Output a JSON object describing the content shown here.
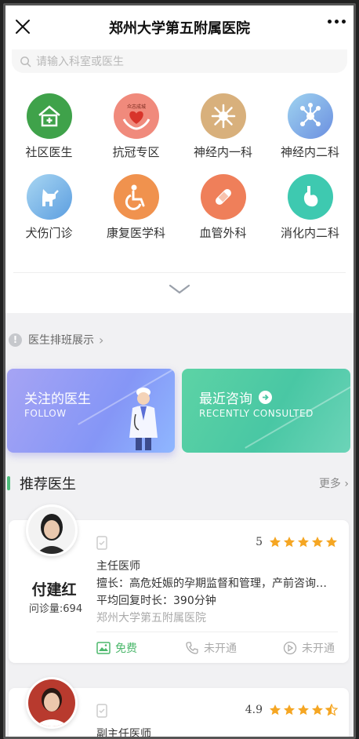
{
  "header": {
    "title": "郑州大学第五附属医院"
  },
  "search": {
    "placeholder": "请输入科室或医生"
  },
  "departments": [
    {
      "label": "社区医生",
      "icon": "community-icon",
      "color": "#3fa24a"
    },
    {
      "label": "抗冠专区",
      "icon": "heart-hands-icon",
      "color": "#f08a7c",
      "badge": "众志成城"
    },
    {
      "label": "神经内一科",
      "icon": "neuron-icon",
      "color": "#d8b07c"
    },
    {
      "label": "神经内二科",
      "icon": "neuron-network-icon",
      "color": "#7aaae0"
    },
    {
      "label": "犬伤门诊",
      "icon": "dog-icon",
      "color": "#7fb6e6"
    },
    {
      "label": "康复医学科",
      "icon": "wheelchair-icon",
      "color": "#f0924e"
    },
    {
      "label": "血管外科",
      "icon": "bandage-icon",
      "color": "#ef7f5a"
    },
    {
      "label": "消化内二科",
      "icon": "stomach-icon",
      "color": "#3ec9b0"
    }
  ],
  "schedule": {
    "label": "医生排班展示"
  },
  "promos": {
    "follow": {
      "title": "关注的医生",
      "subtitle": "FOLLOW"
    },
    "recent": {
      "title": "最近咨询",
      "subtitle": "RECENTLY CONSULTED"
    }
  },
  "recommend": {
    "title": "推荐医生",
    "more": "更多"
  },
  "doctors": [
    {
      "name": "付建红",
      "count": "问诊量:694",
      "rating": "5",
      "stars": 5,
      "title": "主任医师",
      "specialty": "擅长：高危妊娠的孕期监督和管理，产前咨询…",
      "reply": "平均回复时长：390分钟",
      "hospital": "郑州大学第五附属医院",
      "services": {
        "free": "免费",
        "phone": "未开通",
        "video": "未开通"
      }
    },
    {
      "rating": "4.9",
      "stars": 4.5,
      "title": "副主任医师"
    }
  ],
  "colors": {
    "accent": "#4cbb7a",
    "star": "#f5a623"
  }
}
